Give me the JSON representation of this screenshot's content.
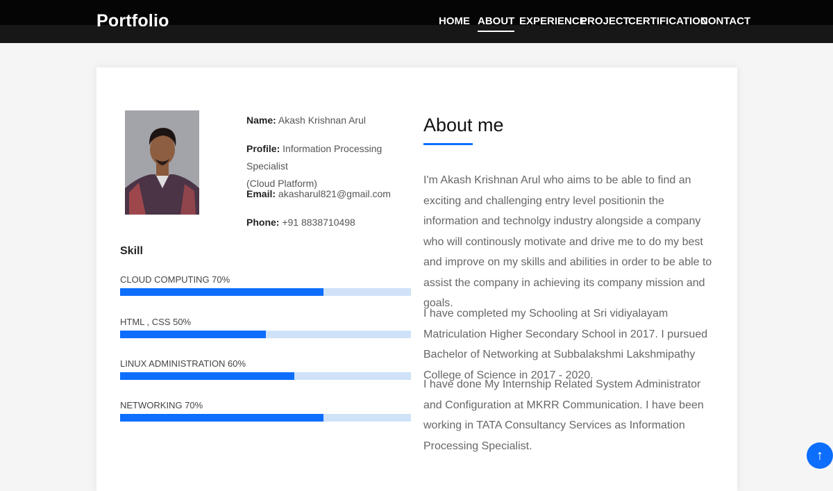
{
  "header": {
    "brand": "Portfolio",
    "nav": [
      "HOME",
      "ABOUT",
      "EXPERIENCE",
      "PROJECT",
      "CERTIFICATION",
      "CONTACT"
    ],
    "active_index": 1
  },
  "profile": {
    "name_label": "Name:",
    "name": "Akash Krishnan Arul",
    "profile_label": "Profile:",
    "profile_line1": "Information Processing Specialist",
    "profile_line2": "(Cloud Platform)",
    "email_label": "Email:",
    "email": "akasharul821@gmail.com",
    "phone_label": "Phone:",
    "phone": "+91 8838710498"
  },
  "skills": {
    "title": "Skill",
    "items": [
      {
        "label": "CLOUD COMPUTING 70%",
        "level": 70
      },
      {
        "label": "HTML , CSS 50%",
        "level": 50
      },
      {
        "label": "LINUX ADMINISTRATION 60%",
        "level": 60
      },
      {
        "label": "NETWORKING 70%",
        "level": 70
      }
    ]
  },
  "about": {
    "title": "About me",
    "paragraphs": [
      "I'm Akash Krishnan Arul who aims to be able to find an exciting and challenging entry level positionin the information and technolgy industry alongside a company who will continously motivate and drive me to do my best and improve on my skills and abilities in order to be able to assist the company in achieving its company mission and goals.",
      "I have completed my Schooling at Sri vidiyalayam Matriculation Higher Secondary School in 2017. I pursued Bachelor of Networking at Subbalakshmi Lakshmipathy College of Science in 2017 - 2020.",
      "I have done My Internship Related System Administrator and Configuration at MKRR Communication. I have been working in TATA Consultancy Services as Information Processing Specialist."
    ]
  },
  "icons": {
    "scroll_top": "arrow-up-icon"
  },
  "colors": {
    "accent": "#0d6efd",
    "bar_track": "#cfe2f8",
    "nav_bg": "#050505"
  }
}
